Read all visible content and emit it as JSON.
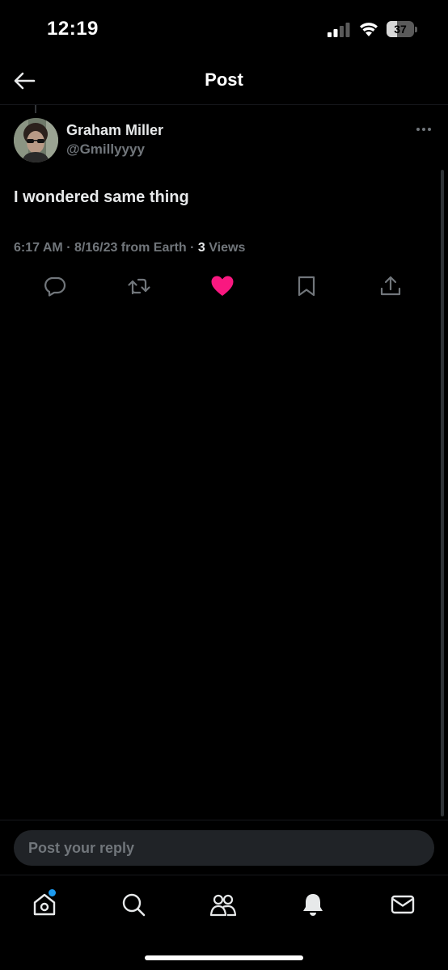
{
  "status_bar": {
    "time": "12:19",
    "battery_level": "37",
    "battery_fraction": 0.37
  },
  "header": {
    "title": "Post",
    "back_icon": "arrow-left-icon"
  },
  "post": {
    "author_name": "Graham Miller",
    "author_handle": "@Gmillyyyy",
    "text": "I wondered same thing",
    "meta_prefix": "6:17 AM · 8/16/23 from Earth · ",
    "views_count": "3",
    "views_label": " Views",
    "liked": true,
    "actions": [
      {
        "name": "reply",
        "icon": "comment-icon"
      },
      {
        "name": "repost",
        "icon": "repost-icon"
      },
      {
        "name": "like",
        "icon": "heart-icon"
      },
      {
        "name": "bookmark",
        "icon": "bookmark-icon"
      },
      {
        "name": "share",
        "icon": "share-icon"
      }
    ]
  },
  "reply": {
    "placeholder": "Post your reply"
  },
  "bottom_nav": {
    "items": [
      "home-icon",
      "search-icon",
      "communities-icon",
      "notifications-icon",
      "messages-icon"
    ],
    "home_has_notification": true
  },
  "colors": {
    "background": "#000000",
    "text_primary": "#e7e9ea",
    "text_secondary": "#71767b",
    "like": "#f91880",
    "accent": "#1d9bf0"
  }
}
